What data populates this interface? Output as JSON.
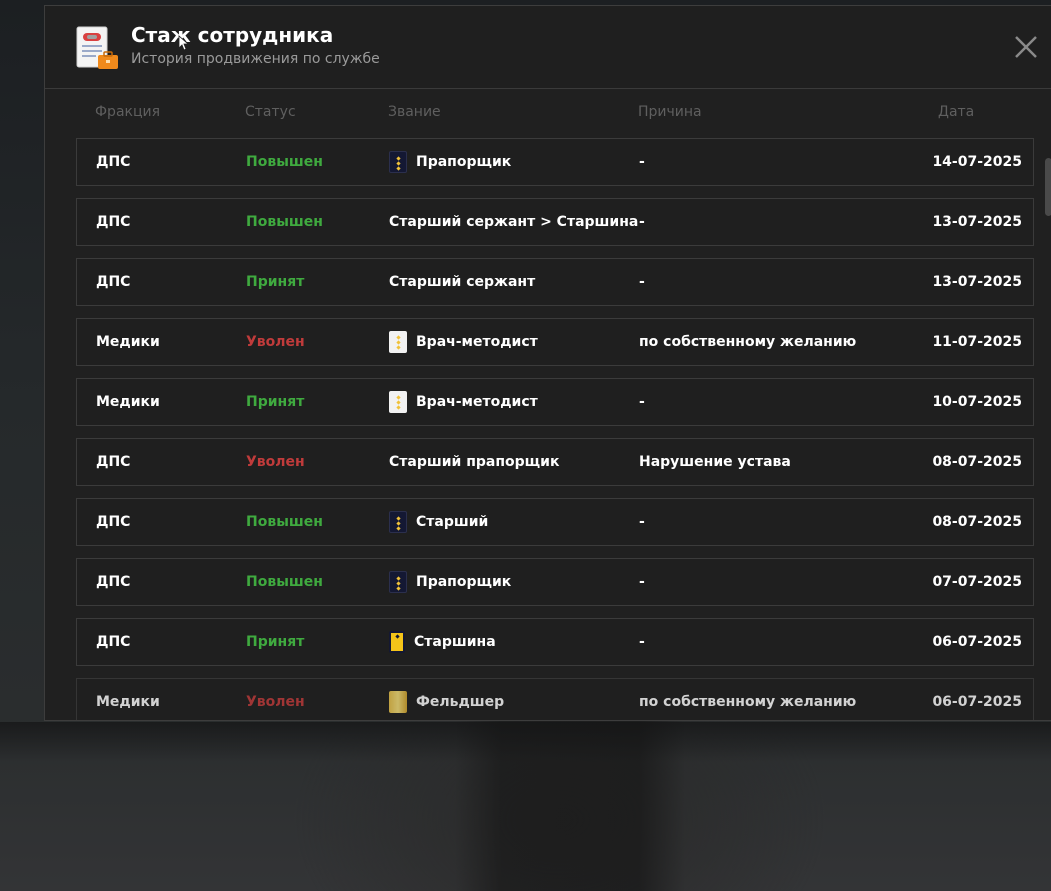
{
  "header": {
    "title": "Стаж сотрудника",
    "subtitle": "История продвижения по службе"
  },
  "columns": {
    "fraction": "Фракция",
    "status": "Статус",
    "rank": "Звание",
    "reason": "Причина",
    "date": "Дата"
  },
  "colors": {
    "promoted": "#3faa3f",
    "fired": "#c03b3b",
    "panel_bg": "#202020"
  },
  "rows": [
    {
      "fraction": "ДПС",
      "status": "Повышен",
      "status_type": "green",
      "rank": "Прапорщик",
      "rank_icon": "dark-shoulder-board-icon",
      "reason": "-",
      "date": "14-07-2025"
    },
    {
      "fraction": "ДПС",
      "status": "Повышен",
      "status_type": "green",
      "rank": "Старший сержант > Старшина",
      "rank_icon": "",
      "reason": "-",
      "date": "13-07-2025"
    },
    {
      "fraction": "ДПС",
      "status": "Принят",
      "status_type": "green",
      "rank": "Старший сержант",
      "rank_icon": "",
      "reason": "-",
      "date": "13-07-2025"
    },
    {
      "fraction": "Медики",
      "status": "Уволен",
      "status_type": "red",
      "rank": "Врач-методист",
      "rank_icon": "white-shoulder-board-icon",
      "reason": "по собственному желанию",
      "date": "11-07-2025"
    },
    {
      "fraction": "Медики",
      "status": "Принят",
      "status_type": "green",
      "rank": "Врач-методист",
      "rank_icon": "white-shoulder-board-icon",
      "reason": "-",
      "date": "10-07-2025"
    },
    {
      "fraction": "ДПС",
      "status": "Уволен",
      "status_type": "red",
      "rank": "Старший прапорщик",
      "rank_icon": "",
      "reason": "Нарушение устава",
      "date": "08-07-2025"
    },
    {
      "fraction": "ДПС",
      "status": "Повышен",
      "status_type": "green",
      "rank": "Старший",
      "rank_icon": "dark-shoulder-board-icon",
      "reason": "-",
      "date": "08-07-2025"
    },
    {
      "fraction": "ДПС",
      "status": "Повышен",
      "status_type": "green",
      "rank": "Прапорщик",
      "rank_icon": "dark-shoulder-board-icon",
      "reason": "-",
      "date": "07-07-2025"
    },
    {
      "fraction": "ДПС",
      "status": "Принят",
      "status_type": "green",
      "rank": "Старшина",
      "rank_icon": "yellow-shoulder-board-icon",
      "reason": "-",
      "date": "06-07-2025"
    },
    {
      "fraction": "Медики",
      "status": "Уволен",
      "status_type": "red",
      "rank": "Фельдшер",
      "rank_icon": "gold-shoulder-board-icon",
      "reason": "по собственному желанию",
      "date": "06-07-2025"
    }
  ]
}
